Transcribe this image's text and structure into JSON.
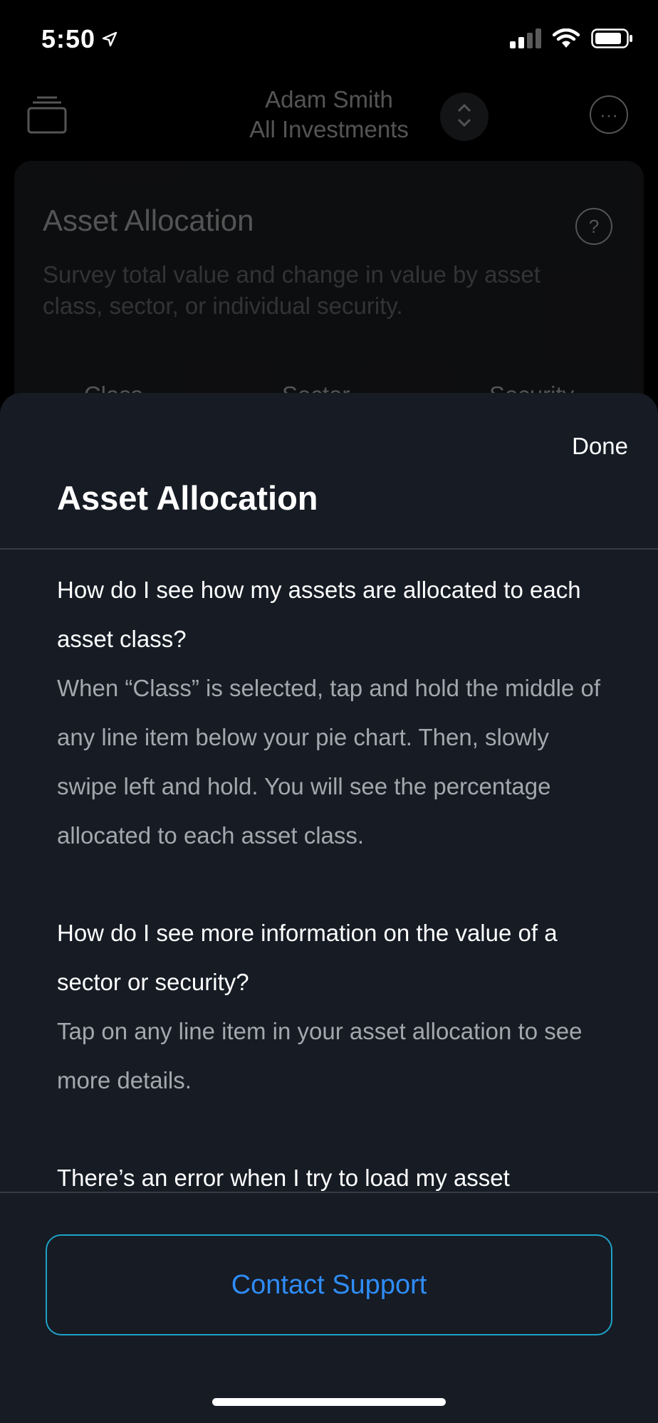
{
  "status_bar": {
    "time": "5:50"
  },
  "background": {
    "account_name": "Adam Smith",
    "account_scope": "All Investments",
    "card_title": "Asset Allocation",
    "card_description": "Survey total value and change in value by asset class, sector, or individual security.",
    "help_glyph": "?",
    "more_glyph": "···",
    "tabs": [
      {
        "label": "Class"
      },
      {
        "label": "Sector"
      },
      {
        "label": "Security"
      }
    ]
  },
  "sheet": {
    "done_label": "Done",
    "title": "Asset Allocation",
    "faq": [
      {
        "question": "How do I see how my assets are allocated to each asset class?",
        "answer": "When “Class” is selected, tap and hold the middle of any line item below your pie chart. Then, slowly swipe left and hold. You will see the percentage allocated to each asset class."
      },
      {
        "question": "How do I see more information on the value of a sector or security?",
        "answer": "Tap on any line item in your asset allocation to see more details."
      },
      {
        "question": "There’s an error when I try to load my asset",
        "answer": ""
      }
    ],
    "contact_label": "Contact Support"
  },
  "colors": {
    "sheet_bg": "#161b24",
    "accent_text": "#2f8cf5",
    "accent_border": "#1fa2c7",
    "answer_text": "#a4a7ad"
  },
  "icons": {
    "location": "location-arrow-icon",
    "signal": "cellular-signal-icon",
    "wifi": "wifi-icon",
    "battery": "battery-icon",
    "stack": "account-stack-icon",
    "switch": "chevron-up-down-icon",
    "more": "more-icon",
    "help": "help-icon"
  }
}
